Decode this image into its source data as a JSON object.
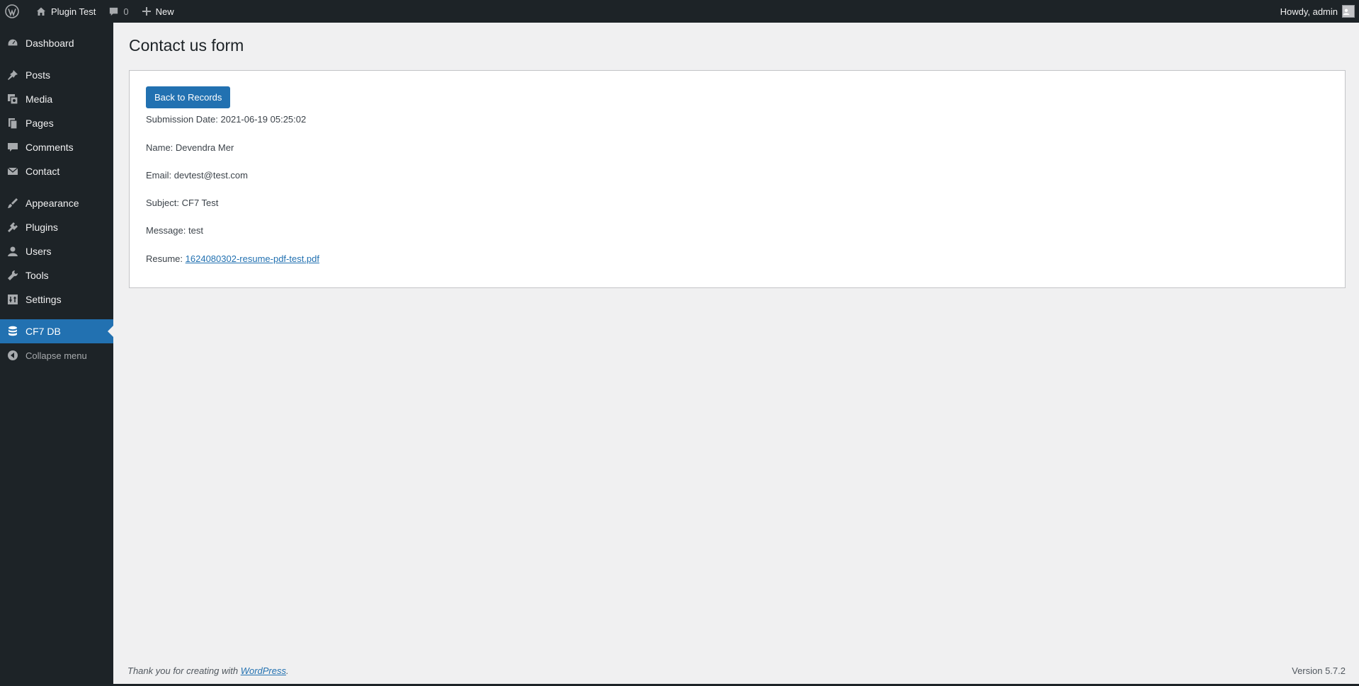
{
  "adminbar": {
    "site_name": "Plugin Test",
    "comments_count": "0",
    "new_label": "New",
    "howdy": "Howdy, admin"
  },
  "sidebar": {
    "items": [
      {
        "label": "Dashboard",
        "icon": "dashboard-icon"
      },
      {
        "label": "Posts",
        "icon": "pin-icon"
      },
      {
        "label": "Media",
        "icon": "media-icon"
      },
      {
        "label": "Pages",
        "icon": "pages-icon"
      },
      {
        "label": "Comments",
        "icon": "comment-icon"
      },
      {
        "label": "Contact",
        "icon": "mail-icon"
      },
      {
        "label": "Appearance",
        "icon": "brush-icon"
      },
      {
        "label": "Plugins",
        "icon": "plugin-icon"
      },
      {
        "label": "Users",
        "icon": "user-icon"
      },
      {
        "label": "Tools",
        "icon": "wrench-icon"
      },
      {
        "label": "Settings",
        "icon": "settings-icon"
      },
      {
        "label": "CF7 DB",
        "icon": "database-icon"
      },
      {
        "label": "Collapse menu",
        "icon": "collapse-icon"
      }
    ]
  },
  "main": {
    "title": "Contact us form",
    "back_button": "Back to Records",
    "fields": [
      {
        "label": "Submission Date:",
        "value": "2021-06-19 05:25:02"
      },
      {
        "label": "Name:",
        "value": "Devendra Mer"
      },
      {
        "label": "Email:",
        "value": "devtest@test.com"
      },
      {
        "label": "Subject:",
        "value": "CF7 Test"
      },
      {
        "label": "Message:",
        "value": "test"
      }
    ],
    "resume_label": "Resume:",
    "resume_file": "1624080302-resume-pdf-test.pdf"
  },
  "footer": {
    "thanks_text": "Thank you for creating with",
    "wordpress_link": "WordPress",
    "period": ".",
    "version": "Version 5.7.2"
  },
  "colors": {
    "accent": "#2271b1",
    "adminbar_bg": "#1d2327",
    "page_bg": "#f0f0f1"
  }
}
